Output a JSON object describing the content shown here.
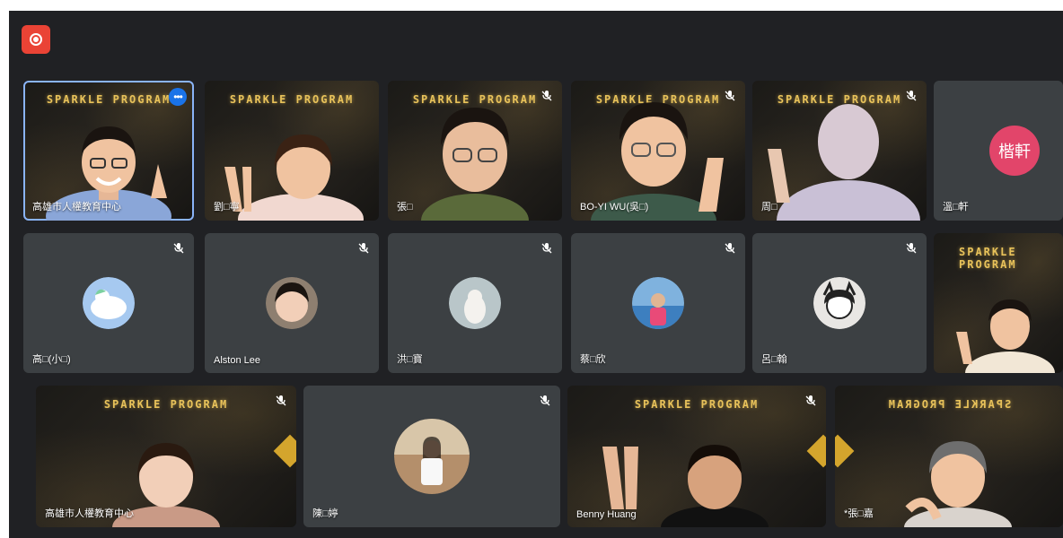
{
  "meeting": {
    "record_icon": "record-icon",
    "banner_text": "SPARKLE PROGRAM",
    "tiles": [
      {
        "id": "t1",
        "name": "高雄市人權教育中心",
        "kind": "video",
        "selected": true,
        "has_more": true
      },
      {
        "id": "t2",
        "name": "劉□寧",
        "kind": "video"
      },
      {
        "id": "t3",
        "name": "張□",
        "kind": "video",
        "muted": true
      },
      {
        "id": "t4",
        "name": "BO-YI WU(吳□)",
        "kind": "video",
        "muted": true
      },
      {
        "id": "t5",
        "name": "周□",
        "kind": "video",
        "muted": true
      },
      {
        "id": "t6",
        "name": "溫□軒",
        "kind": "avatar",
        "avatar_text": "楷軒",
        "avatar_color": "#e2456a"
      },
      {
        "id": "t7",
        "name": "高□(小□)",
        "kind": "avatar",
        "muted": true
      },
      {
        "id": "t8",
        "name": "Alston Lee",
        "kind": "avatar",
        "muted": true
      },
      {
        "id": "t9",
        "name": "洪□寶",
        "kind": "avatar",
        "muted": true
      },
      {
        "id": "t10",
        "name": "蔡□欣",
        "kind": "avatar",
        "muted": true
      },
      {
        "id": "t11",
        "name": "呂□翰",
        "kind": "avatar",
        "muted": true
      },
      {
        "id": "t12",
        "name": "",
        "kind": "video"
      },
      {
        "id": "t13",
        "name": "高雄市人權教育中心",
        "kind": "video",
        "muted": true
      },
      {
        "id": "t14",
        "name": "陳□婷",
        "kind": "avatar",
        "muted": true
      },
      {
        "id": "t15",
        "name": "Benny Huang",
        "kind": "video",
        "muted": true
      },
      {
        "id": "t16",
        "name": "*張□嘉",
        "kind": "video",
        "muted": true
      }
    ]
  }
}
